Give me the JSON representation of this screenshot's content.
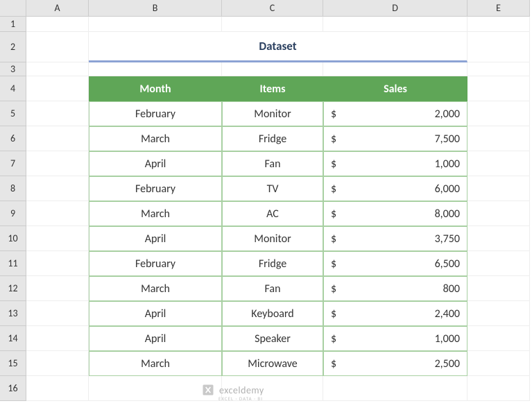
{
  "columns": [
    "",
    "A",
    "B",
    "C",
    "D",
    "E"
  ],
  "row_numbers": [
    "1",
    "2",
    "3",
    "4",
    "5",
    "6",
    "7",
    "8",
    "9",
    "10",
    "11",
    "12",
    "13",
    "14",
    "15",
    "16"
  ],
  "title": "Dataset",
  "headers": {
    "month": "Month",
    "items": "Items",
    "sales": "Sales"
  },
  "currency": "$",
  "rows": [
    {
      "month": "February",
      "items": "Monitor",
      "sales": "2,000"
    },
    {
      "month": "March",
      "items": "Fridge",
      "sales": "7,500"
    },
    {
      "month": "April",
      "items": "Fan",
      "sales": "1,000"
    },
    {
      "month": "February",
      "items": "TV",
      "sales": "6,000"
    },
    {
      "month": "March",
      "items": "AC",
      "sales": "8,000"
    },
    {
      "month": "April",
      "items": "Monitor",
      "sales": "3,750"
    },
    {
      "month": "February",
      "items": "Fridge",
      "sales": "6,500"
    },
    {
      "month": "March",
      "items": "Fan",
      "sales": "800"
    },
    {
      "month": "April",
      "items": "Keyboard",
      "sales": "2,400"
    },
    {
      "month": "April",
      "items": "Speaker",
      "sales": "1,000"
    },
    {
      "month": "March",
      "items": "Microwave",
      "sales": "2,500"
    }
  ],
  "watermark": {
    "text": "exceldemy",
    "sub": "EXCEL · DATA · BI"
  }
}
